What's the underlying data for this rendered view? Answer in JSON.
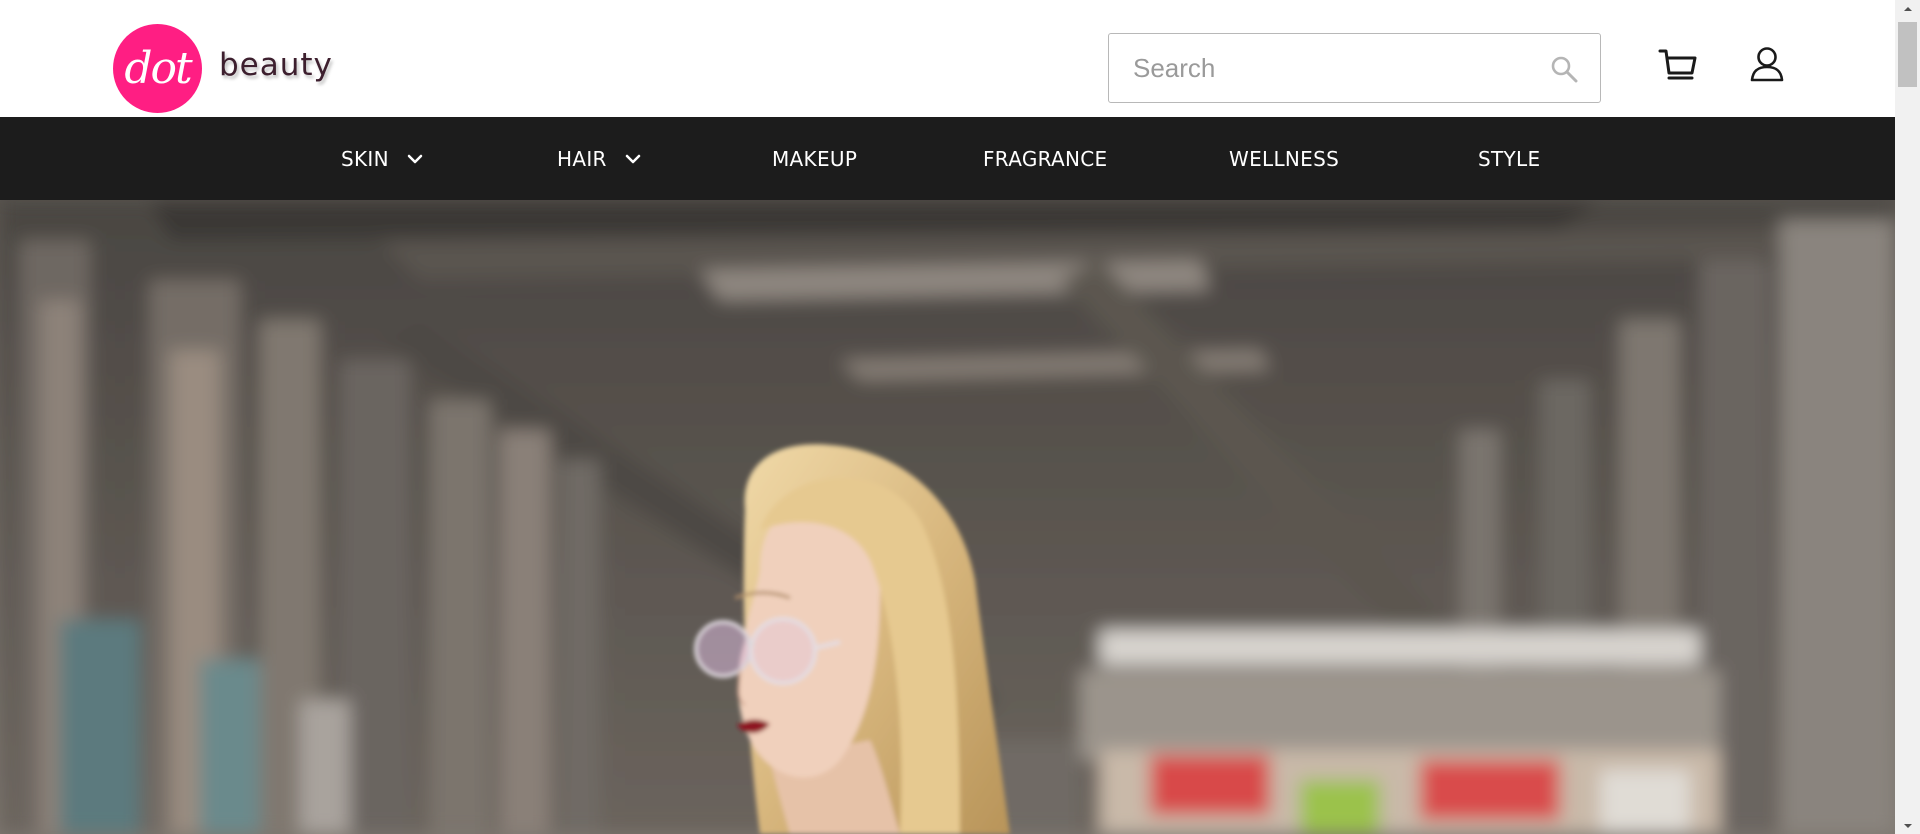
{
  "brand": {
    "logo_mark": "dot",
    "logo_word": "beauty",
    "accent_color": "#ff1e83"
  },
  "header": {
    "search": {
      "placeholder": "Search",
      "value": "",
      "icon": "search-icon"
    },
    "cart": {
      "icon": "cart-icon"
    },
    "account": {
      "icon": "user-icon"
    }
  },
  "nav": {
    "background_color": "#1c1c1c",
    "items": [
      {
        "label": "SKIN",
        "has_dropdown": true
      },
      {
        "label": "HAIR",
        "has_dropdown": true
      },
      {
        "label": "MAKEUP",
        "has_dropdown": false
      },
      {
        "label": "FRAGRANCE",
        "has_dropdown": false
      },
      {
        "label": "WELLNESS",
        "has_dropdown": false
      },
      {
        "label": "STYLE",
        "has_dropdown": false
      }
    ]
  },
  "hero": {
    "image_subject": "blonde woman with round glasses in urban underpass"
  }
}
